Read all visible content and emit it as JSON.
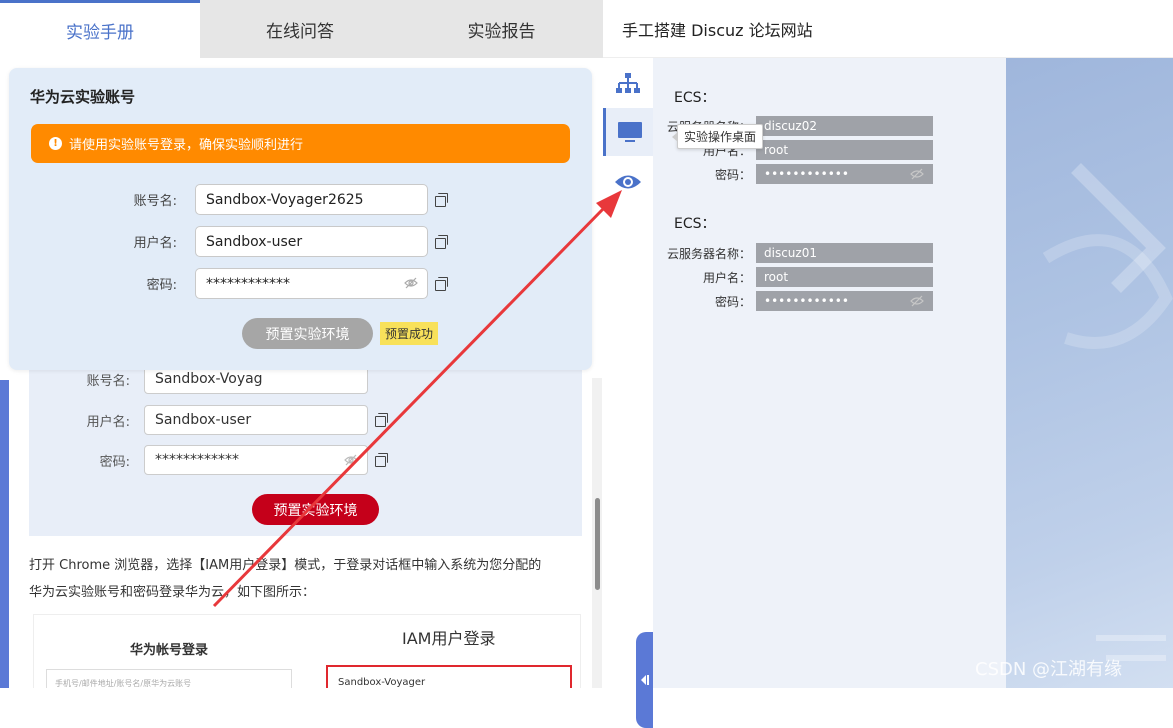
{
  "tabs": [
    "实验手册",
    "在线问答",
    "实验报告"
  ],
  "card": {
    "title": "华为云实验账号",
    "alert": "请使用实验账号登录，确保实验顺利进行",
    "fields": [
      {
        "label": "账号名:",
        "value": "Sandbox-Voyager2625"
      },
      {
        "label": "用户名:",
        "value": "Sandbox-user"
      },
      {
        "label": "密码:",
        "value": "************"
      }
    ],
    "button": "预置实验环境",
    "badge": "预置成功"
  },
  "doc": {
    "fields": [
      {
        "label": "账号名:",
        "value": "Sandbox-Voyag"
      },
      {
        "label": "用户名:",
        "value": "Sandbox-user"
      },
      {
        "label": "密码:",
        "value": "************"
      }
    ],
    "button": "预置实验环境",
    "paragraph_line1": "打开 Chrome 浏览器，选择【IAM用户登录】模式，于登录对话框中输入系统为您分配的",
    "paragraph_line2": "华为云实验账号和密码登录华为云，如下图所示：",
    "shot_title_left": "华为帐号登录",
    "shot_title_right": "IAM用户登录",
    "shot_placeholder": "手机号/邮件地址/账号名/原华为云账号",
    "shot_account": "Sandbox-Voyager"
  },
  "right": {
    "header_title": "手工搭建 Discuz 论坛网站",
    "tooltip": "实验操作桌面",
    "ecs": [
      {
        "title": "ECS：",
        "rows": [
          {
            "label": "云服务器名称：",
            "value": "discuz02"
          },
          {
            "label": "用户名：",
            "value": "root"
          },
          {
            "label": "密码：",
            "value": "••••••••••••"
          }
        ]
      },
      {
        "title": "ECS：",
        "rows": [
          {
            "label": "云服务器名称：",
            "value": "discuz01"
          },
          {
            "label": "用户名：",
            "value": "root"
          },
          {
            "label": "密码：",
            "value": "••••••••••••"
          }
        ]
      }
    ]
  },
  "watermark": "CSDN @江湖有缘",
  "colors": {
    "accent": "#4a72c9",
    "alert": "#ff8a00",
    "primary_button": "#c5001a",
    "arrow": "#e8383b"
  }
}
